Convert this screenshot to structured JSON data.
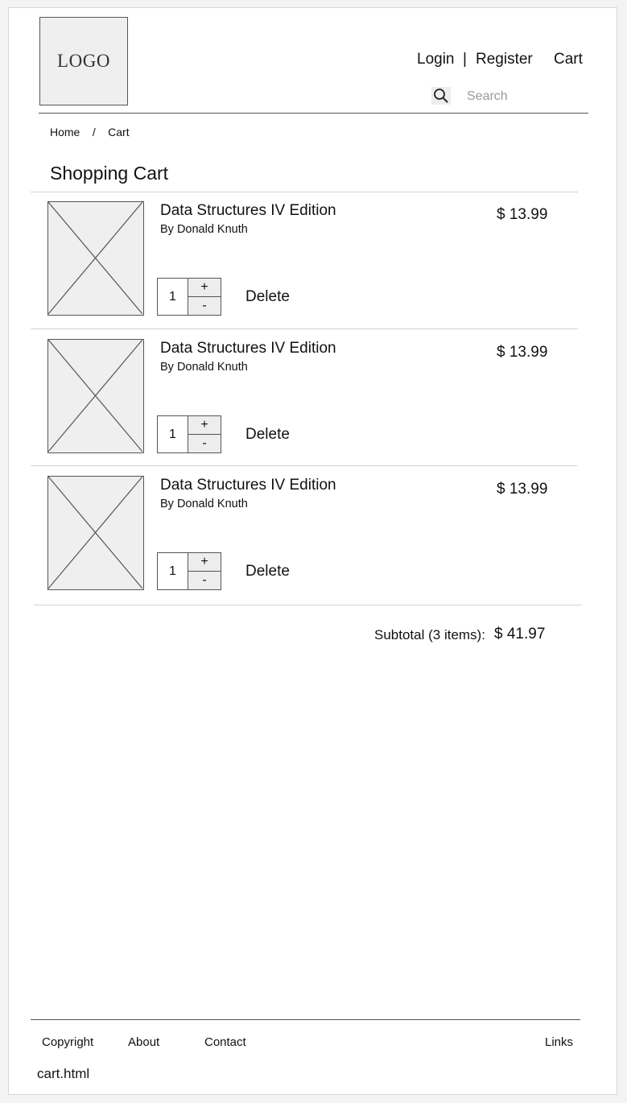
{
  "header": {
    "logo_text": "LOGO",
    "nav": {
      "login": "Login",
      "separator": "|",
      "register": "Register",
      "cart": "Cart"
    },
    "search": {
      "placeholder": "Search",
      "value": ""
    }
  },
  "breadcrumb": {
    "home": "Home",
    "separator": "/",
    "current": "Cart"
  },
  "page_title": "Shopping Cart",
  "cart_items": [
    {
      "title": "Data Structures IV Edition",
      "author": "By Donald Knuth",
      "price": "$ 13.99",
      "quantity": "1",
      "plus": "+",
      "minus": "-",
      "delete_label": "Delete"
    },
    {
      "title": "Data Structures IV Edition",
      "author": "By Donald Knuth",
      "price": "$ 13.99",
      "quantity": "1",
      "plus": "+",
      "minus": "-",
      "delete_label": "Delete"
    },
    {
      "title": "Data Structures IV Edition",
      "author": "By Donald Knuth",
      "price": "$ 13.99",
      "quantity": "1",
      "plus": "+",
      "minus": "-",
      "delete_label": "Delete"
    }
  ],
  "subtotal": {
    "label": "Subtotal (3 items):",
    "value": "$ 41.97"
  },
  "footer": {
    "links": {
      "copyright": "Copyright",
      "about": "About",
      "contact": "Contact",
      "links": "Links"
    },
    "filename": "cart.html"
  },
  "colors": {
    "border_dark": "#555555",
    "divider_light": "#d3d3d3",
    "placeholder_fill": "#efefef",
    "muted_text": "#9a9a9a"
  }
}
